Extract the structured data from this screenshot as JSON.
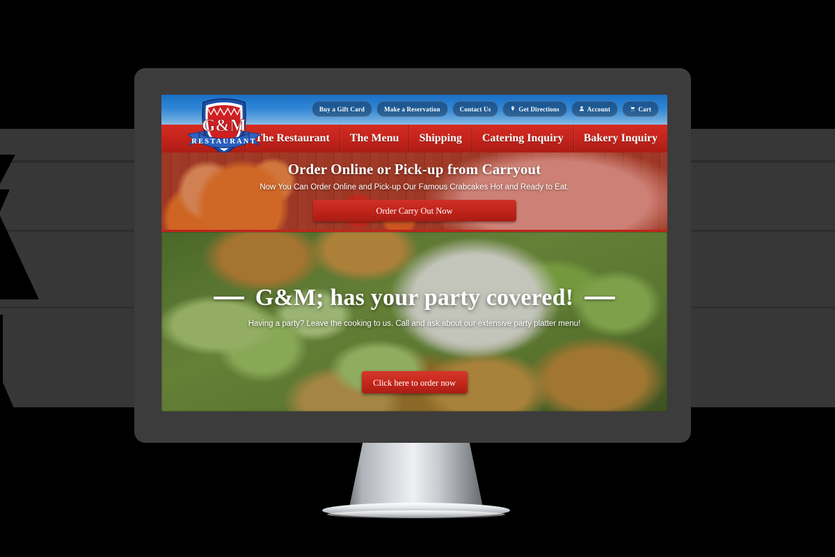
{
  "site": {
    "brand": {
      "name": "G&M",
      "subtitle": "RESTAURANT"
    },
    "topbar": {
      "buttons": [
        {
          "label": "Buy a Gift Card",
          "icon": ""
        },
        {
          "label": "Make a Reservation",
          "icon": ""
        },
        {
          "label": "Contact Us",
          "icon": ""
        },
        {
          "label": "Get Directions",
          "icon": "map-pin-icon"
        },
        {
          "label": "Account",
          "icon": "user-icon"
        },
        {
          "label": "Cart",
          "icon": "cart-icon"
        }
      ]
    },
    "nav": {
      "items": [
        {
          "label": "The Restaurant"
        },
        {
          "label": "The Menu"
        },
        {
          "label": "Shipping"
        },
        {
          "label": "Catering Inquiry"
        },
        {
          "label": "Bakery Inquiry"
        }
      ]
    },
    "promo": {
      "title": "Order Online or Pick-up from Carryout",
      "subtitle": "Now You Can Order Online and Pick-up Our Famous Crabcakes Hot and Ready to Eat.",
      "button_label": "Order Carry Out Now"
    },
    "hero": {
      "title": "G&M; has your party covered!",
      "subtitle": "Having a party? Leave the cooking to us. Call and ask about our extensive party platter menu!",
      "button_label": "Click here to order now"
    },
    "colors": {
      "brand_red": "#c2231b",
      "brand_blue": "#2f86d6",
      "bezel": "#3d3c3c",
      "backdrop": "#373737"
    }
  }
}
